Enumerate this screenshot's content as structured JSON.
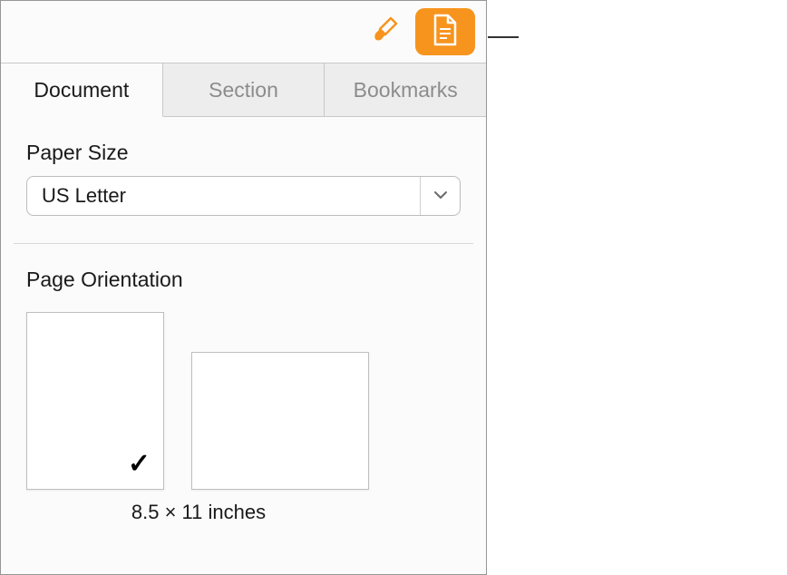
{
  "toolbar": {
    "format_icon_color": "#f7941e",
    "document_icon_color": "#ffffff",
    "document_button_bg": "#f7941e"
  },
  "tabs": [
    {
      "label": "Document",
      "active": true
    },
    {
      "label": "Section",
      "active": false
    },
    {
      "label": "Bookmarks",
      "active": false
    }
  ],
  "paper_size": {
    "label": "Paper Size",
    "selected": "US Letter"
  },
  "page_orientation": {
    "label": "Page Orientation",
    "selected": "portrait",
    "dimensions": "8.5 × 11 inches",
    "checkmark": "✓"
  }
}
